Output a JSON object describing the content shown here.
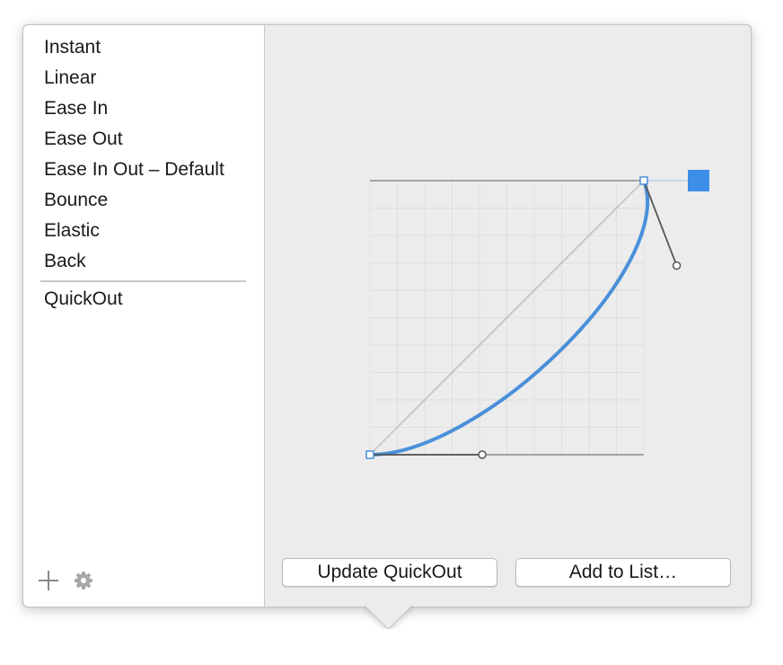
{
  "sidebar": {
    "presets": [
      "Instant",
      "Linear",
      "Ease In",
      "Ease Out",
      "Ease In Out – Default",
      "Bounce",
      "Elastic",
      "Back"
    ],
    "custom": [
      "QuickOut"
    ],
    "add_icon": "plus-icon",
    "settings_icon": "gear-icon"
  },
  "editor": {
    "curve": {
      "start": [
        0,
        0
      ],
      "control1": [
        0.41,
        0.0
      ],
      "control2": [
        1.12,
        0.69
      ],
      "end": [
        1,
        1
      ]
    },
    "grid_divisions": 10,
    "curve_color": "#4a90d9",
    "handle_color": "#555555",
    "swatch_color": "#3d8ee6",
    "update_label": "Update QuickOut",
    "add_label": "Add to List…"
  }
}
